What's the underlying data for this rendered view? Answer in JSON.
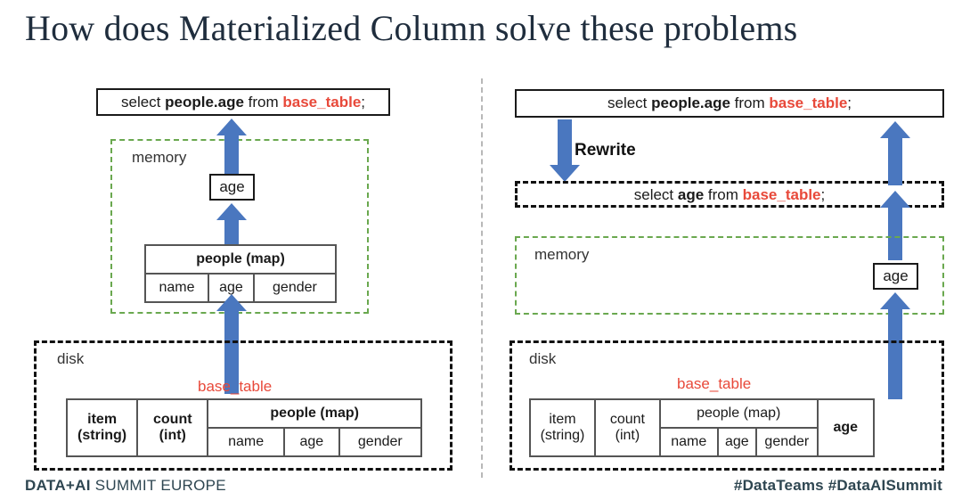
{
  "slide": {
    "title": "How does Materialized Column solve these problems"
  },
  "left": {
    "query": {
      "prefix": "select ",
      "bold": "people.age",
      "middle": " from ",
      "table": "base_table",
      "suffix": ";"
    },
    "memory_label": "memory",
    "age_box": "age",
    "memory_table": {
      "header": "people (map)",
      "subcolumns": [
        "name",
        "age",
        "gender"
      ]
    },
    "disk_label": "disk",
    "base_table_label": "base_table",
    "disk_table": {
      "columns": [
        {
          "line1": "item",
          "line2": "(string)"
        },
        {
          "line1": "count",
          "line2": "(int)"
        }
      ],
      "map_header": "people (map)",
      "map_subcolumns": [
        "name",
        "age",
        "gender"
      ]
    }
  },
  "right": {
    "query": {
      "prefix": "select ",
      "bold": "people.age",
      "middle": " from ",
      "table": "base_table",
      "suffix": ";"
    },
    "rewrite_label": "Rewrite",
    "rewritten_query": {
      "prefix": "select ",
      "bold": "age",
      "middle": " from ",
      "table": "base_table",
      "suffix": ";"
    },
    "memory_label": "memory",
    "age_box": "age",
    "disk_label": "disk",
    "base_table_label": "base_table",
    "disk_table": {
      "columns": [
        {
          "line1": "item",
          "line2": "(string)"
        },
        {
          "line1": "count",
          "line2": "(int)"
        }
      ],
      "map_header": "people (map)",
      "map_subcolumns": [
        "name",
        "age",
        "gender"
      ],
      "materialized_column": "age"
    }
  },
  "footer": {
    "left_bold": "DATA+AI",
    "left_rest": " SUMMIT EUROPE",
    "right": "#DataTeams  #DataAISummit"
  },
  "colors": {
    "arrow_blue": "#4A77BF",
    "memory_green": "#6aa84f",
    "table_red": "#e8493a",
    "title_navy": "#1f2d3d",
    "footer_slate": "#2e4651"
  }
}
